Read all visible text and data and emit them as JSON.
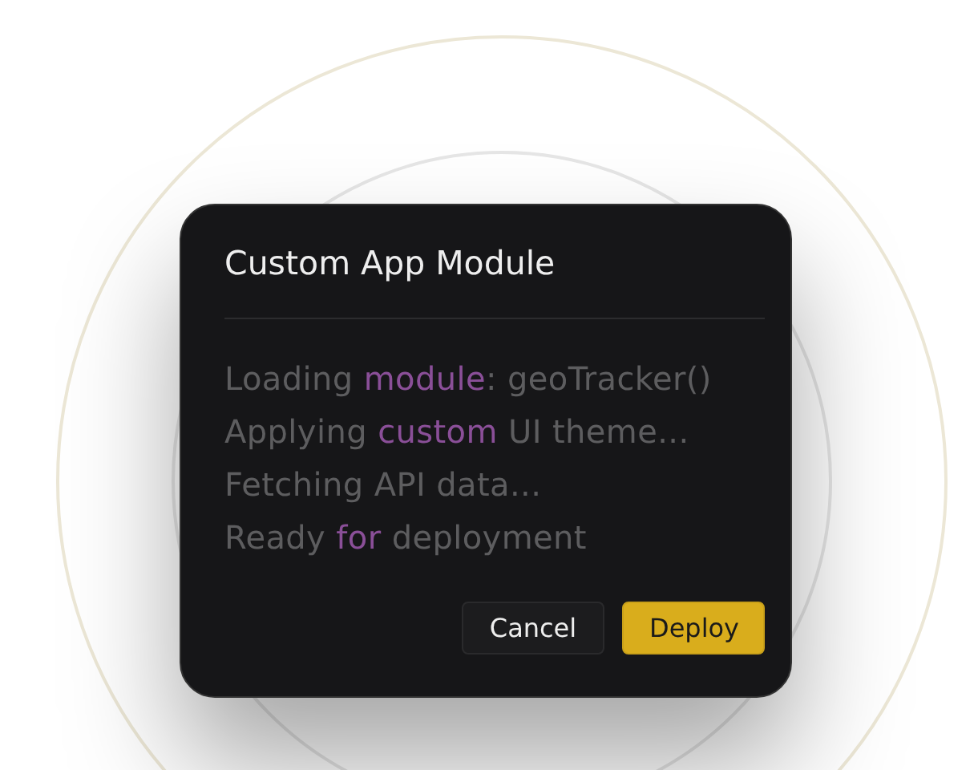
{
  "dialog": {
    "title": "Custom App Module",
    "lines": [
      [
        {
          "text": "Loading ",
          "highlight": false
        },
        {
          "text": "module",
          "highlight": true
        },
        {
          "text": ": geoTracker()",
          "highlight": false
        }
      ],
      [
        {
          "text": "Applying ",
          "highlight": false
        },
        {
          "text": "custom",
          "highlight": true
        },
        {
          "text": " UI theme...",
          "highlight": false
        }
      ],
      [
        {
          "text": "Fetching API data...",
          "highlight": false
        }
      ],
      [
        {
          "text": "Ready ",
          "highlight": false
        },
        {
          "text": "for",
          "highlight": true
        },
        {
          "text": " deployment",
          "highlight": false
        }
      ]
    ],
    "buttons": [
      {
        "label": "Cancel",
        "kind": "secondary"
      },
      {
        "label": "Deploy",
        "kind": "primary"
      }
    ]
  }
}
